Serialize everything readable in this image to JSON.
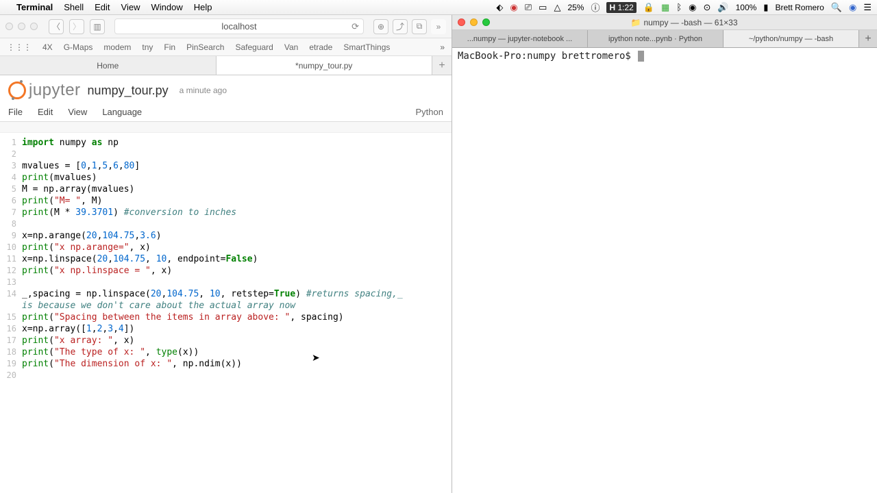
{
  "menubar": {
    "app": "Terminal",
    "menus": [
      "Shell",
      "Edit",
      "View",
      "Window",
      "Help"
    ],
    "battery": "25%",
    "clock": "1:22",
    "user": "Brett Romero",
    "batt_pct": "100%"
  },
  "browser": {
    "address": "localhost",
    "bookmarks": [
      "4X",
      "G-Maps",
      "modem",
      "tny",
      "Fin",
      "PinSearch",
      "Safeguard",
      "Van",
      "etrade",
      "SmartThings"
    ],
    "tabs": [
      "Home",
      "*numpy_tour.py"
    ]
  },
  "jupyter": {
    "logo_text": "jupyter",
    "filename": "numpy_tour.py",
    "timestamp": "a minute ago",
    "menus": [
      "File",
      "Edit",
      "View",
      "Language"
    ],
    "kernel": "Python"
  },
  "code_lines": [
    {
      "n": 1,
      "html": "<span class='kw'>import</span> numpy <span class='kw'>as</span> np"
    },
    {
      "n": 2,
      "html": ""
    },
    {
      "n": 3,
      "html": "mvalues = [<span class='num'>0</span>,<span class='num'>1</span>,<span class='num'>5</span>,<span class='num'>6</span>,<span class='num'>80</span>]"
    },
    {
      "n": 4,
      "html": "<span class='builtin'>print</span>(mvalues)"
    },
    {
      "n": 5,
      "html": "M = np.array(mvalues)"
    },
    {
      "n": 6,
      "html": "<span class='builtin'>print</span>(<span class='str'>\"M= \"</span>, M)"
    },
    {
      "n": 7,
      "html": "<span class='builtin'>print</span>(M * <span class='num'>39.3701</span>) <span class='com'>#conversion to inches</span>"
    },
    {
      "n": 8,
      "html": ""
    },
    {
      "n": 9,
      "html": "x=np.arange(<span class='num'>20</span>,<span class='num'>104.75</span>,<span class='num'>3.6</span>)"
    },
    {
      "n": 10,
      "html": "<span class='builtin'>print</span>(<span class='str'>\"x np.arange=\"</span>, x)"
    },
    {
      "n": 11,
      "html": "x=np.linspace(<span class='num'>20</span>,<span class='num'>104.75</span>, <span class='num'>10</span>, endpoint=<span class='bool'>False</span>)"
    },
    {
      "n": 12,
      "html": "<span class='builtin'>print</span>(<span class='str'>\"x np.linspace = \"</span>, x)"
    },
    {
      "n": 13,
      "html": ""
    },
    {
      "n": 14,
      "html": "_,spacing = np.linspace(<span class='num'>20</span>,<span class='num'>104.75</span>, <span class='num'>10</span>, retstep=<span class='bool'>True</span>) <span class='com'>#returns spacing,_</span>"
    },
    {
      "n": 15,
      "html": "<span class='com'>is because we don't care about the actual array now</span>"
    },
    {
      "n": 15,
      "hn": 15,
      "html": "<span class='builtin'>print</span>(<span class='str'>\"Spacing between the items in array above: \"</span>, spacing)"
    },
    {
      "n": 16,
      "html": "x=np.array([<span class='num'>1</span>,<span class='num'>2</span>,<span class='num'>3</span>,<span class='num'>4</span>])"
    },
    {
      "n": 17,
      "html": "<span class='builtin'>print</span>(<span class='str'>\"x array: \"</span>, x)"
    },
    {
      "n": 18,
      "html": "<span class='builtin'>print</span>(<span class='str'>\"The type of x: \"</span>, <span class='builtin'>type</span>(x))"
    },
    {
      "n": 19,
      "html": "<span class='builtin'>print</span>(<span class='str'>\"The dimension of x: \"</span>, np.ndim(x))"
    },
    {
      "n": 20,
      "html": ""
    }
  ],
  "terminal": {
    "title": "numpy — -bash — 61×33",
    "tabs": [
      "...numpy — jupyter-notebook  ...",
      "ipython note...pynb · Python",
      "~/python/numpy — -bash"
    ],
    "prompt": "MacBook-Pro:numpy brettromero$ "
  }
}
